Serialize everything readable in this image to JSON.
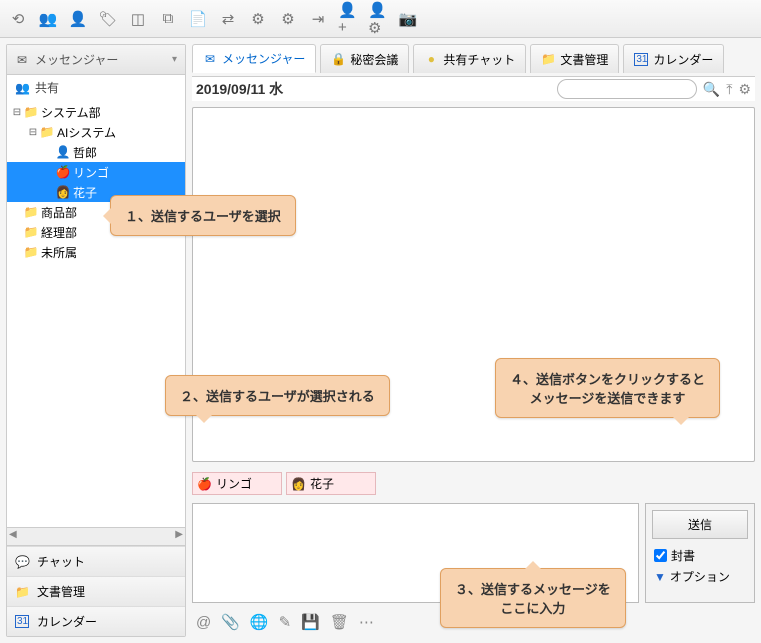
{
  "date": "2019/09/11 水",
  "sidebar": {
    "title": "メッセンジャー",
    "share": "共有",
    "nav": {
      "chat": "チャット",
      "docs": "文書管理",
      "calendar": "カレンダー"
    }
  },
  "tree": [
    {
      "indent": 0,
      "expander": "⊟",
      "icon": "📁",
      "iconClass": "folder",
      "label": "システム部",
      "sel": false
    },
    {
      "indent": 1,
      "expander": "⊟",
      "icon": "📁",
      "iconClass": "folder",
      "label": "AIシステム",
      "sel": false
    },
    {
      "indent": 2,
      "expander": "",
      "icon": "👤",
      "iconClass": "",
      "label": "哲郎",
      "sel": false
    },
    {
      "indent": 2,
      "expander": "",
      "icon": "🍎",
      "iconClass": "",
      "label": "リンゴ",
      "sel": true
    },
    {
      "indent": 2,
      "expander": "",
      "icon": "👩",
      "iconClass": "",
      "label": "花子",
      "sel": true
    },
    {
      "indent": 0,
      "expander": "",
      "icon": "📁",
      "iconClass": "folder",
      "label": "商品部",
      "sel": false
    },
    {
      "indent": 0,
      "expander": "",
      "icon": "📁",
      "iconClass": "folder",
      "label": "経理部",
      "sel": false
    },
    {
      "indent": 0,
      "expander": "",
      "icon": "📁",
      "iconClass": "folder",
      "label": "未所属",
      "sel": false
    }
  ],
  "tabs": {
    "messenger": "メッセンジャー",
    "secret": "秘密会議",
    "shared": "共有チャット",
    "docs": "文書管理",
    "calendar": "カレンダー"
  },
  "recipients": [
    {
      "icon": "🍎",
      "name": "リンゴ"
    },
    {
      "icon": "👩",
      "name": "花子"
    }
  ],
  "send": {
    "button": "送信",
    "sealed": "封書",
    "options": "オプション"
  },
  "callouts": {
    "c1": "１、送信するユーザを選択",
    "c2": "２、送信するユーザが選択される",
    "c3": "３、送信するメッセージを\nここに入力",
    "c4": "４、送信ボタンをクリックすると\nメッセージを送信できます"
  },
  "calendar_num": "31"
}
